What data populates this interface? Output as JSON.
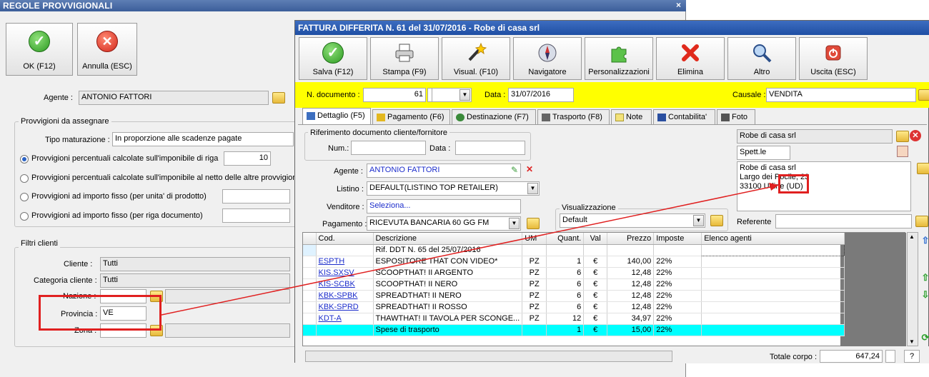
{
  "left_window": {
    "title": "REGOLE PROVVIGIONALI",
    "close": "×",
    "ok_label": "OK (F12)",
    "cancel_label": "Annulla (ESC)",
    "agente_label": "Agente :",
    "agente_value": "ANTONIO FATTORI",
    "group1_title": "Provvigioni da assegnare",
    "tipo_label": "Tipo maturazione :",
    "tipo_value": "In proporzione alle scadenze pagate",
    "radio1": "Provvigioni percentuali calcolate sull'imponibile di riga",
    "radio1_value": "10",
    "radio2": "Provvigioni percentuali calcolate sull'imponibile al netto delle altre provvigioni",
    "radio3": "Provvigioni ad importo fisso (per unita' di prodotto)",
    "radio4": "Provvigioni ad importo fisso (per riga documento)",
    "group2_title": "Filtri clienti",
    "cliente_label": "Cliente :",
    "cliente_value": "Tutti",
    "categoria_label": "Categoria cliente :",
    "categoria_value": "Tutti",
    "nazione_label": "Nazione :",
    "provincia_label": "Provincia :",
    "provincia_value": "VE",
    "zona_label": "Zona :"
  },
  "right_window": {
    "title": "FATTURA DIFFERITA N. 61 del 31/07/2016 - Robe di casa srl",
    "toolbar": [
      {
        "label": "Salva (F12)",
        "icon": "check-icon"
      },
      {
        "label": "Stampa (F9)",
        "icon": "printer-icon"
      },
      {
        "label": "Visual. (F10)",
        "icon": "magic-wand-icon"
      },
      {
        "label": "Navigatore",
        "icon": "compass-icon"
      },
      {
        "label": "Personalizzazioni",
        "icon": "puzzle-icon"
      },
      {
        "label": "Elimina",
        "icon": "delete-x-icon"
      },
      {
        "label": "Altro",
        "icon": "magnifier-icon"
      },
      {
        "label": "Uscita (ESC)",
        "icon": "power-icon"
      }
    ],
    "ndoc_label": "N. documento :",
    "ndoc_value": "61",
    "data_label": "Data :",
    "data_value": "31/07/2016",
    "causale_label": "Causale :",
    "causale_value": "VENDITA",
    "tabs": [
      {
        "label": "Dettaglio (F5)",
        "icon": "list-icon"
      },
      {
        "label": "Pagamento (F6)",
        "icon": "payment-icon"
      },
      {
        "label": "Destinazione (F7)",
        "icon": "globe-icon"
      },
      {
        "label": "Trasporto (F8)",
        "icon": "truck-icon"
      },
      {
        "label": "Note",
        "icon": "note-icon"
      },
      {
        "label": "Contabilita'",
        "icon": "book-icon"
      },
      {
        "label": "Foto",
        "icon": "camera-icon"
      }
    ],
    "rif_title": "Riferimento documento cliente/fornitore",
    "num_label": "Num.:",
    "data2_label": "Data :",
    "agente_label": "Agente :",
    "agente_value": "ANTONIO FATTORI",
    "listino_label": "Listino :",
    "listino_value": "DEFAULT(LISTINO TOP RETAILER)",
    "venditore_label": "Venditore :",
    "venditore_value": "Seleziona...",
    "pagamento_label": "Pagamento :",
    "pagamento_value": "RICEVUTA BANCARIA 60 GG FM",
    "visual_title": "Visualizzazione",
    "visual_value": "Default",
    "cliente_name": "Robe di casa srl",
    "spett": "Spett.le",
    "address_lines": [
      "Robe di casa srl",
      "Largo dei Pocile, 23",
      "33100 Udine (UD)"
    ],
    "referente_label": "Referente",
    "grid_headers": [
      "",
      "Cod.",
      "Descrizione",
      "UM",
      "Quant.",
      "Val",
      "Prezzo",
      "Imposte",
      "Elenco agenti"
    ],
    "grid_rows": [
      {
        "cod": "",
        "desc": "Rif. DDT N. 65 del 25/07/2016",
        "um": "",
        "qty": "",
        "val": "",
        "prezzo": "",
        "imp": ""
      },
      {
        "cod": "ESPTH",
        "desc": "ESPOSITORE THAT CON VIDEO*",
        "um": "PZ",
        "qty": "1",
        "val": "€",
        "prezzo": "140,00",
        "imp": "22%"
      },
      {
        "cod": "KIS.SXSV",
        "desc": "SCOOPTHAT! II ARGENTO",
        "um": "PZ",
        "qty": "6",
        "val": "€",
        "prezzo": "12,48",
        "imp": "22%"
      },
      {
        "cod": "KIS-SCBK",
        "desc": "SCOOPTHAT! II NERO",
        "um": "PZ",
        "qty": "6",
        "val": "€",
        "prezzo": "12,48",
        "imp": "22%"
      },
      {
        "cod": "KBK-SPBK",
        "desc": "SPREADTHAT! II NERO",
        "um": "PZ",
        "qty": "6",
        "val": "€",
        "prezzo": "12,48",
        "imp": "22%"
      },
      {
        "cod": "KBK-SPRD",
        "desc": "SPREADTHAT! II ROSSO",
        "um": "PZ",
        "qty": "6",
        "val": "€",
        "prezzo": "12,48",
        "imp": "22%"
      },
      {
        "cod": "KDT-A",
        "desc": "THAWTHAT! II  TAVOLA PER SCONGE...",
        "um": "PZ",
        "qty": "12",
        "val": "€",
        "prezzo": "34,97",
        "imp": "22%"
      },
      {
        "cod": "",
        "desc": "Spese di trasporto",
        "um": "",
        "qty": "1",
        "val": "€",
        "prezzo": "15,00",
        "imp": "22%"
      }
    ],
    "totale_label": "Totale corpo :",
    "totale_value": "647,24",
    "help": "?"
  },
  "colors": {
    "highlight": "#e02020",
    "yellow_bar": "#ffff00",
    "selected_row": "#00ffff",
    "titlebar": "#2a58a8"
  }
}
